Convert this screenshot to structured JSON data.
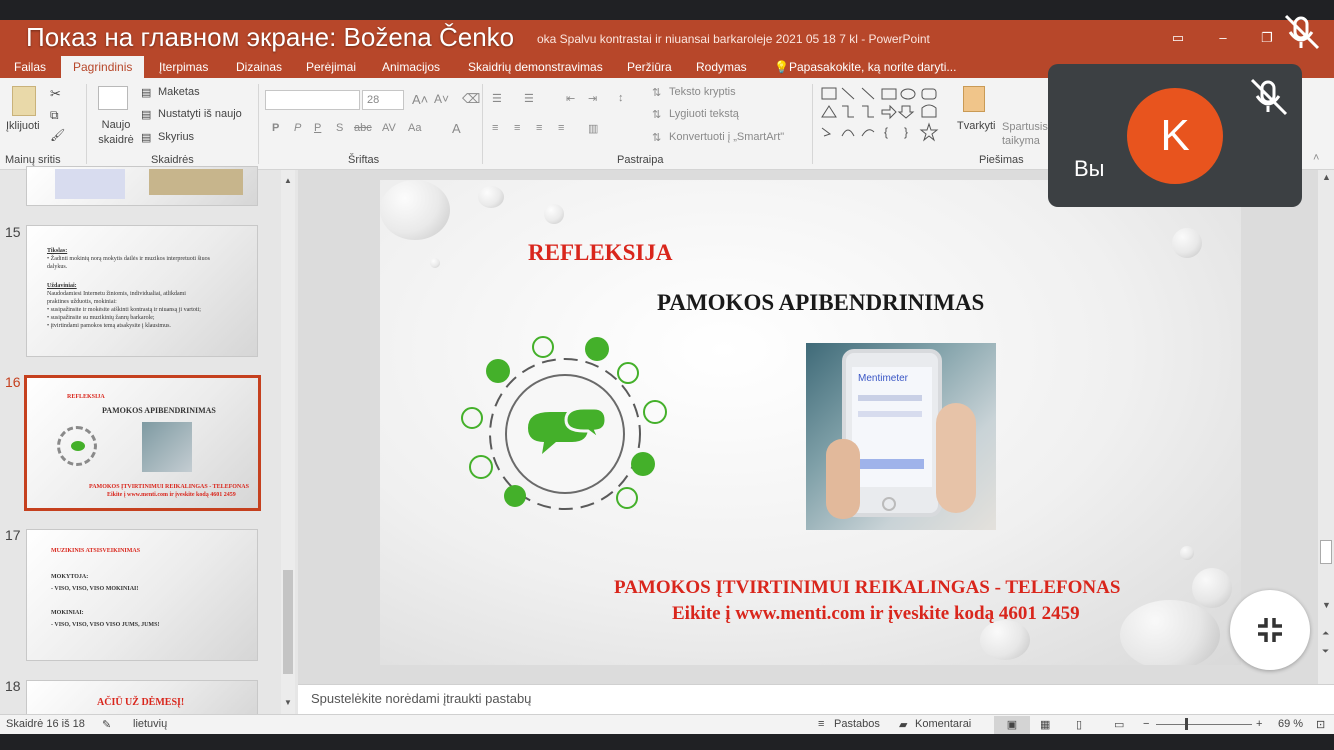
{
  "meeting": {
    "share_banner": "Показ на главном экране: Božena Čenko",
    "self_label": "Вы",
    "avatar_letter": "K",
    "avatar_color": "#e8541e"
  },
  "app": {
    "title_visible": "oka Spalvu kontrastai ir niuansai barkaroleje 2021 05 18 7 kl - PowerPoint",
    "brand_color": "#b7472a"
  },
  "tabs": [
    {
      "label": "Failas"
    },
    {
      "label": "Pagrindinis"
    },
    {
      "label": "Įterpimas"
    },
    {
      "label": "Dizainas"
    },
    {
      "label": "Perėjimai"
    },
    {
      "label": "Animacijos"
    },
    {
      "label": "Skaidrių demonstravimas"
    },
    {
      "label": "Peržiūra"
    },
    {
      "label": "Rodymas"
    }
  ],
  "tell_me": "Papasakokite, ką norite daryti...",
  "ribbon": {
    "paste": "Įklijuoti",
    "new_slide": "Naujo skaidrė",
    "layout": "Maketas",
    "reset": "Nustatyti iš naujo",
    "section": "Skyrius",
    "font_size": "28",
    "text_direction": "Teksto kryptis",
    "align_text": "Lygiuoti tekstą",
    "smartart": "Konvertuoti į „SmartArt\"",
    "arrange": "Tvarkyti",
    "quick_styles": "Spartusis taikyma",
    "groups": {
      "clipboard": "Mainų sritis",
      "slides": "Skaidrės",
      "font": "Šriftas",
      "paragraph": "Pastraipa",
      "drawing": "Piešimas"
    }
  },
  "thumbnails": [
    {
      "num": "15",
      "lines": [
        "Tikslas:",
        "• Žadinti mokinių norą mokytis dailės ir muzikos interpretuoti šiuos",
        "  dalykus.",
        "Uždaviniai:",
        "      Naudodamiesi Internetu žiniomis, individualiai, atlikdami",
        "  praktines užduotis, mokiniai:",
        "• susipažinsite ir mokėsite aiškinti kontrastą ir niuansą ji vartoti;",
        "• susipažinsite su muzikinių žanrų barkarole;",
        "• įtvirtindami pamokos temą atsakysite į klausimus."
      ]
    },
    {
      "num": "16",
      "small_title": "REFLEKSIJA",
      "small_heading": "PAMOKOS APIBENDRINIMAS",
      "small_footer_1": "PAMOKOS ĮTVIRTINIMUI REIKALINGAS - TELEFONAS",
      "small_footer_2": "Eikite į www.menti.com ir įveskite kodą 4601 2459"
    },
    {
      "num": "17",
      "lines": [
        "MUZIKINIS ATSISVEIKINIMAS",
        "MOKYTOJA:",
        "- VISO, VISO, VISO MOKINIAI!",
        "MOKINIAI:",
        "- VISO, VISO, VISO VISO JUMS, JUMS!"
      ]
    },
    {
      "num": "18",
      "title": "AČIŪ UŽ DĖMESĮ!"
    }
  ],
  "slide": {
    "title_red": "REFLEKSIJA",
    "heading": "PAMOKOS APIBENDRINIMAS",
    "footer_line1": "PAMOKOS ĮTVIRTINIMUI REIKALINGAS - TELEFONAS",
    "footer_line2": "Eikite į www.menti.com ir įveskite kodą 4601 2459",
    "phone_brand": "Mentimeter",
    "accent_red": "#d9261c",
    "accent_green": "#44b02a"
  },
  "notes_placeholder": "Spustelėkite norėdami įtraukti pastabų",
  "status": {
    "slide_info": "Skaidrė 16 iš 18",
    "language": "lietuvių",
    "notes": "Pastabos",
    "comments": "Komentarai",
    "zoom": "69 %"
  }
}
